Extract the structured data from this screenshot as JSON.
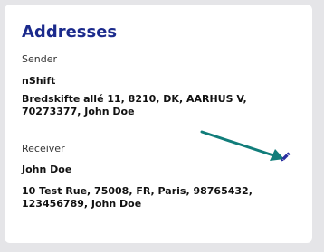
{
  "addresses": {
    "title": "Addresses",
    "sender": {
      "label": "Sender",
      "name": "nShift",
      "address": "Bredskifte allé 11, 8210, DK, AARHUS V, 70273377, John Doe"
    },
    "receiver": {
      "label": "Receiver",
      "name": "John Doe",
      "address": "10 Test Rue, 75008, FR, Paris, 98765432, 123456789, John Doe"
    },
    "edit_icon": "pencil-icon"
  },
  "colors": {
    "title": "#1b2a8c",
    "edit_icon": "#2a2fa0",
    "annotation_arrow": "#117d7a",
    "background": "#e5e5e8",
    "card": "#ffffff"
  }
}
